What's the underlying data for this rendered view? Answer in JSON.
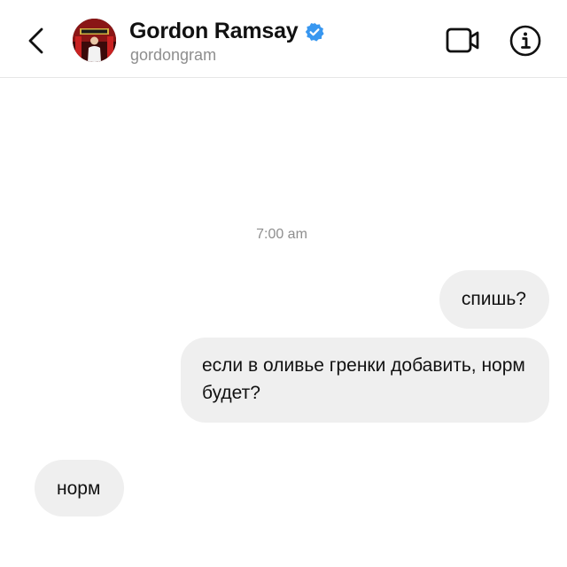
{
  "header": {
    "contact_name": "Gordon Ramsay",
    "username": "gordongram",
    "verified": true,
    "icons": [
      "back-chevron-icon",
      "verified-badge-icon",
      "video-call-icon",
      "info-icon"
    ]
  },
  "chat": {
    "timestamp": "7:00 am",
    "messages": [
      {
        "direction": "outgoing",
        "text": "спишь?"
      },
      {
        "direction": "outgoing",
        "text": "если в оливье гренки добавить, норм будет?"
      },
      {
        "direction": "incoming",
        "text": "норм"
      }
    ]
  },
  "colors": {
    "bubble_bg": "#efefef",
    "secondary_text": "#8e8e8e",
    "verified_blue": "#3897f0",
    "divider": "#e6e6e6"
  }
}
